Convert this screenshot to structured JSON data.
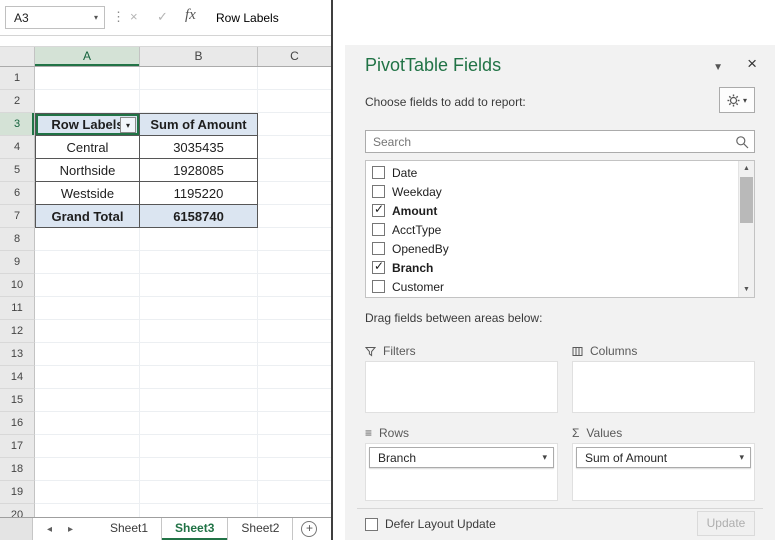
{
  "colors": {
    "accent_green": "#217346",
    "pivot_header_blue": "#dbe5f1"
  },
  "icons": {
    "dropdown": "▾",
    "check": "✓",
    "close": "×",
    "cancel": "×",
    "enter": "✓",
    "separator_dots": "⋮",
    "scroll_up": "▲",
    "scroll_down": "▼",
    "tab_prev": "◂",
    "tab_next": "▸",
    "rows_area": "≡",
    "values_area": "Σ",
    "new_sheet": "+",
    "name_box_dropdown": "▾",
    "pane_options": "▼"
  },
  "formula_bar": {
    "name_box_value": "A3",
    "fx_label": "fx",
    "content": "Row Labels"
  },
  "grid": {
    "col_headers": [
      "A",
      "B",
      "C"
    ],
    "row_numbers": [
      "1",
      "2",
      "3",
      "4",
      "5",
      "6",
      "7",
      "8",
      "9",
      "10",
      "11",
      "12",
      "13",
      "14",
      "15",
      "16",
      "17",
      "18",
      "19",
      "20"
    ]
  },
  "pivot": {
    "header_row": {
      "col_a": "Row Labels",
      "col_b": "Sum of Amount"
    },
    "rows": [
      {
        "col_a": "Central",
        "col_b": "3035435"
      },
      {
        "col_a": "Northside",
        "col_b": "1928085"
      },
      {
        "col_a": "Westside",
        "col_b": "1195220"
      }
    ],
    "total_row": {
      "col_a": "Grand Total",
      "col_b": "6158740"
    }
  },
  "sheet_bar": {
    "tabs": [
      "Sheet1",
      "Sheet3",
      "Sheet2"
    ],
    "active_tab": "Sheet3"
  },
  "pane": {
    "title": "PivotTable Fields",
    "choose_label": "Choose fields to add to report:",
    "search": {
      "placeholder": "Search"
    },
    "fields": [
      {
        "name": "Date",
        "checked": false
      },
      {
        "name": "Weekday",
        "checked": false
      },
      {
        "name": "Amount",
        "checked": true
      },
      {
        "name": "AcctType",
        "checked": false
      },
      {
        "name": "OpenedBy",
        "checked": false
      },
      {
        "name": "Branch",
        "checked": true
      },
      {
        "name": "Customer",
        "checked": false
      }
    ],
    "drag_label": "Drag fields between areas below:",
    "areas": {
      "filters": {
        "label": "Filters",
        "items": []
      },
      "columns": {
        "label": "Columns",
        "items": []
      },
      "rows": {
        "label": "Rows",
        "items": [
          "Branch"
        ]
      },
      "values": {
        "label": "Values",
        "items": [
          "Sum of Amount"
        ]
      }
    },
    "defer_label": "Defer Layout Update",
    "update_label": "Update"
  }
}
